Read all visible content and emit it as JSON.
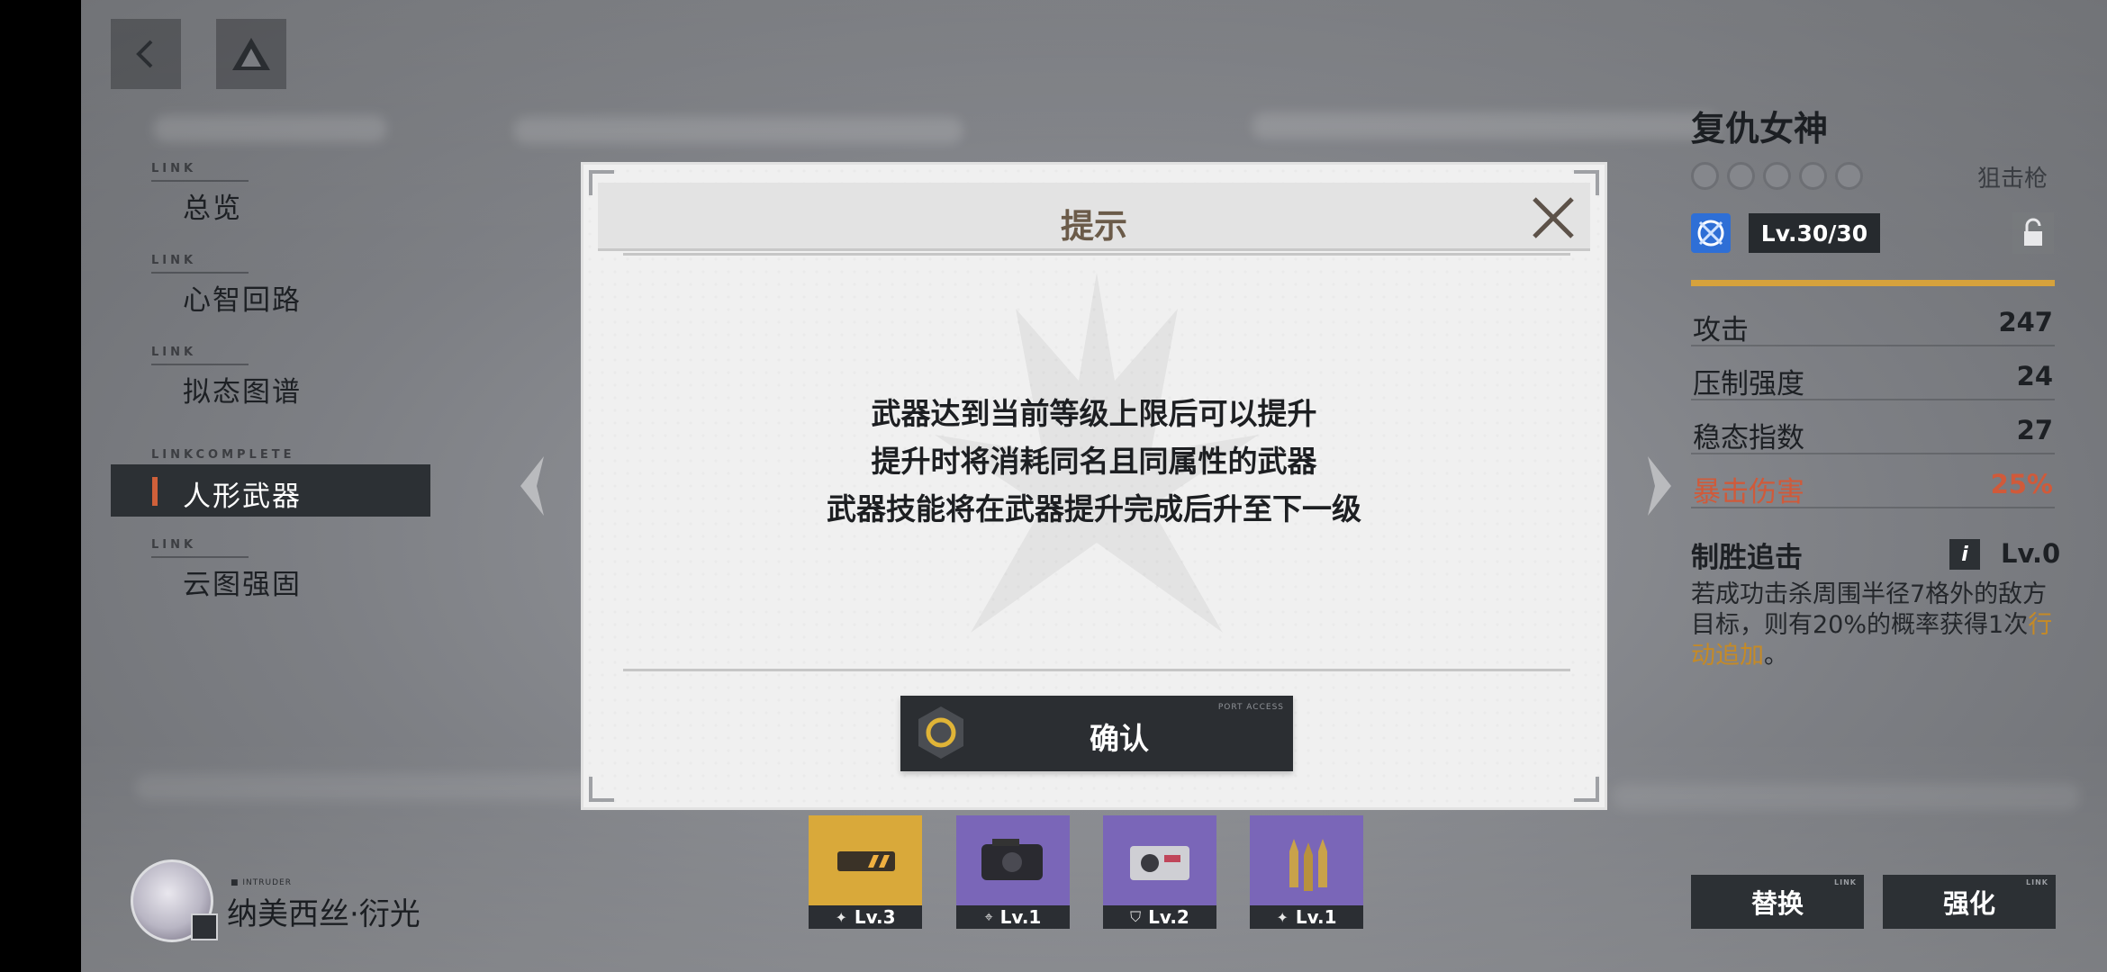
{
  "nav": {
    "back": "back",
    "home": "home"
  },
  "menu": [
    {
      "tag": "LINK",
      "label": "总览"
    },
    {
      "tag": "LINK",
      "label": "心智回路"
    },
    {
      "tag": "LINK",
      "label": "拟态图谱"
    },
    {
      "tag": "LINKCOMPLETE",
      "label": "人形武器"
    },
    {
      "tag": "LINK",
      "label": "云图强固"
    }
  ],
  "character": {
    "sub": "■ INTRUDER",
    "name": "纳美西丝·衍光"
  },
  "weapon": {
    "name": "复仇女神",
    "type": "狙击枪",
    "level": "Lv.30/30",
    "stars_filled": 0,
    "stars_total": 5,
    "stats": [
      {
        "label": "攻击",
        "value": "247"
      },
      {
        "label": "压制强度",
        "value": "24"
      },
      {
        "label": "稳态指数",
        "value": "27"
      },
      {
        "label": "暴击伤害",
        "value": "25%"
      }
    ],
    "skill": {
      "name": "制胜追击",
      "info_icon": "i",
      "level": "Lv.0",
      "desc_before": "若成功击杀周围半径7格外的敌方目标，则有20%的概率获得1次",
      "desc_highlight": "行动追加",
      "desc_after": "。"
    }
  },
  "buttons": {
    "replace": "替换",
    "enhance": "强化",
    "replace_tag": "LINK",
    "enhance_tag": "LINK"
  },
  "attachments": [
    {
      "level": "Lv.3",
      "icon": "wings-icon",
      "color": "#d9a93a"
    },
    {
      "level": "Lv.1",
      "icon": "crosshair-icon",
      "color": "#7a66b8"
    },
    {
      "level": "Lv.2",
      "icon": "shield-icon",
      "color": "#7a66b8"
    },
    {
      "level": "Lv.1",
      "icon": "wings-icon",
      "color": "#7a66b8"
    }
  ],
  "modal": {
    "title": "提示",
    "lines": [
      "武器达到当前等级上限后可以提升",
      "提升时将消耗同名且同属性的武器",
      "武器技能将在武器提升完成后升至下一级"
    ],
    "confirm": "确认",
    "confirm_tag": "PORT ACCESS"
  },
  "colors": {
    "accent_gold": "#d6a23c",
    "crit_red": "#d05a3a",
    "title_brown": "#6b5b49"
  }
}
